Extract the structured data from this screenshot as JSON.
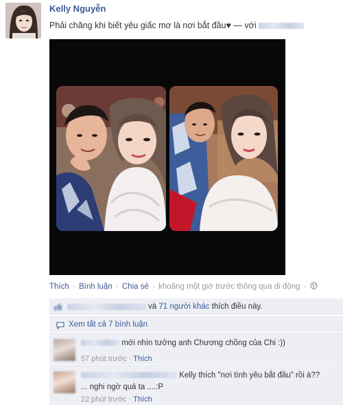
{
  "post": {
    "author": "Kelly Nguyễn",
    "status": "Phải chăng khi biết yêu giấc mơ là nơi bắt đầu♥",
    "with_sep": "—",
    "with_label": "với"
  },
  "actions": {
    "like": "Thích",
    "comment": "Bình luận",
    "share": "Chia sẻ",
    "time_via": "khoảng một giờ trước thông qua di động",
    "globe_icon": "globe-icon"
  },
  "likes": {
    "prefix": "và",
    "others_link": "71 người khác",
    "suffix": "thích điều này."
  },
  "view_all": {
    "label": "Xem tất cả 7 bình luận",
    "icon": "comment-bubble-icon"
  },
  "comments": [
    {
      "text": "mới nhìn tưởng anh Chương chồng của Chi :))",
      "time": "57 phút trước",
      "like": "Thích"
    },
    {
      "text_line1": "Kelly thích \"nơi tình yêu bắt đầu\" rồi à??",
      "text_line2": "... nghi ngờ quá ta ....:P",
      "time": "22 phút trước",
      "like": "Thích"
    }
  ],
  "colors": {
    "link": "#3b5998",
    "meta": "#999999",
    "box_bg": "#edeff4",
    "photo_bg": "#080808"
  }
}
